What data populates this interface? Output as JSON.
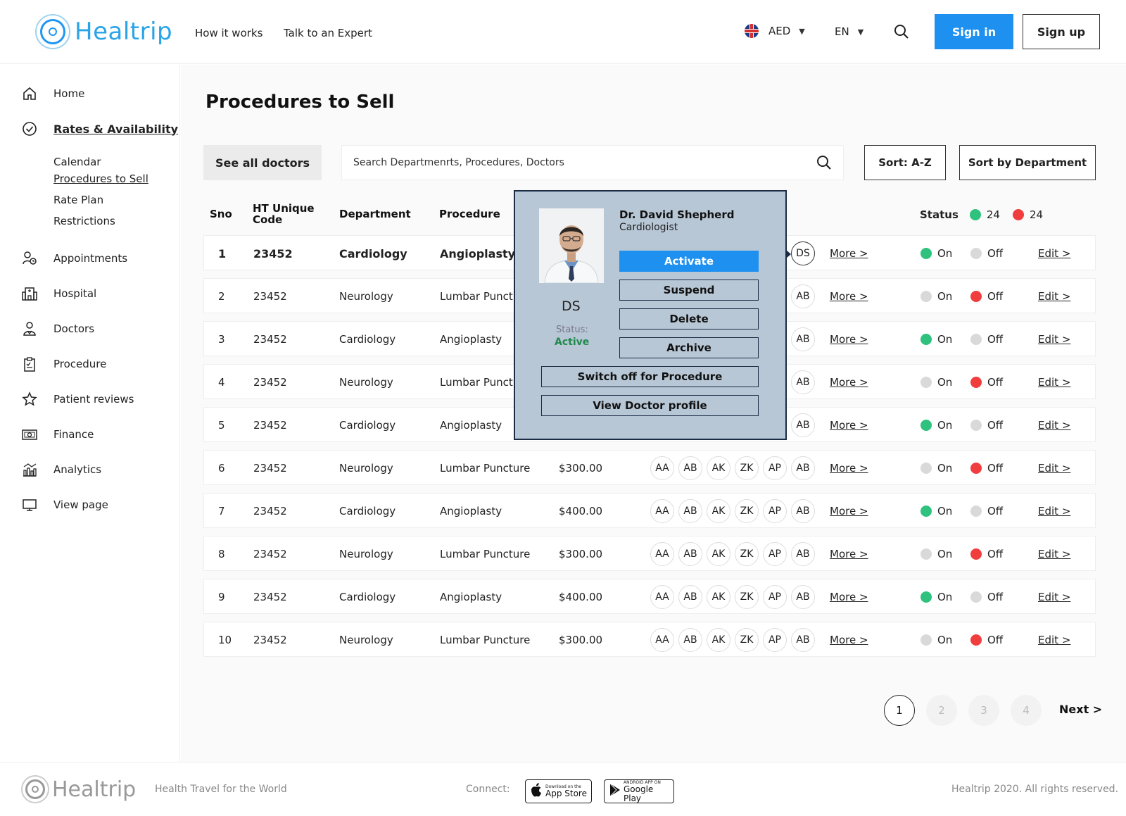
{
  "header": {
    "logo_text": "Healtrip",
    "nav": [
      "How it works",
      "Talk to an Expert"
    ],
    "currency": "AED",
    "language": "EN",
    "signin_label": "Sign in",
    "signup_label": "Sign up"
  },
  "sidebar": {
    "items": [
      {
        "label": "Home",
        "icon": "home-icon"
      },
      {
        "label": "Rates & Availability",
        "icon": "check-circle-icon",
        "active": true
      },
      {
        "label": "Appointments",
        "icon": "appointments-icon"
      },
      {
        "label": "Hospital",
        "icon": "hospital-icon"
      },
      {
        "label": "Doctors",
        "icon": "doctor-icon"
      },
      {
        "label": "Procedure",
        "icon": "clipboard-icon"
      },
      {
        "label": "Patient reviews",
        "icon": "star-icon"
      },
      {
        "label": "Finance",
        "icon": "money-icon"
      },
      {
        "label": "Analytics",
        "icon": "analytics-icon"
      },
      {
        "label": "View page",
        "icon": "monitor-icon"
      }
    ],
    "subitems": [
      "Calendar",
      "Procedures to Sell",
      "Rate Plan",
      "Restrictions"
    ]
  },
  "main": {
    "title": "Procedures to Sell",
    "see_all_label": "See all doctors",
    "search_placeholder": "Search Departmenrts, Procedures, Doctors",
    "sort_az_label": "Sort: A-Z",
    "sort_dept_label": "Sort by Department"
  },
  "table": {
    "headers": {
      "sno": "Sno",
      "code_line1": "HT Unique",
      "code_line2": "Code",
      "department": "Department",
      "procedure": "Procedure",
      "status": "Status"
    },
    "status_counts": {
      "on": "24",
      "off": "24"
    },
    "more_label": "More >",
    "edit_label": "Edit >",
    "on_label": "On",
    "off_label": "Off",
    "rows": [
      {
        "sno": "1",
        "code": "23452",
        "department": "Cardiology",
        "procedure": "Angioplasty",
        "price": "",
        "doctors": [
          "DS"
        ],
        "status": "on"
      },
      {
        "sno": "2",
        "code": "23452",
        "department": "Neurology",
        "procedure": "Lumbar Puncture",
        "price": "",
        "doctors": [
          "AB"
        ],
        "status": "off"
      },
      {
        "sno": "3",
        "code": "23452",
        "department": "Cardiology",
        "procedure": "Angioplasty",
        "price": "",
        "doctors": [
          "AB"
        ],
        "status": "on"
      },
      {
        "sno": "4",
        "code": "23452",
        "department": "Neurology",
        "procedure": "Lumbar Puncture",
        "price": "",
        "doctors": [
          "AB"
        ],
        "status": "off"
      },
      {
        "sno": "5",
        "code": "23452",
        "department": "Cardiology",
        "procedure": "Angioplasty",
        "price": "",
        "doctors": [
          "AB"
        ],
        "status": "on"
      },
      {
        "sno": "6",
        "code": "23452",
        "department": "Neurology",
        "procedure": "Lumbar Puncture",
        "price": "$300.00",
        "doctors": [
          "AA",
          "AB",
          "AK",
          "ZK",
          "AP",
          "AB"
        ],
        "status": "off"
      },
      {
        "sno": "7",
        "code": "23452",
        "department": "Cardiology",
        "procedure": "Angioplasty",
        "price": "$400.00",
        "doctors": [
          "AA",
          "AB",
          "AK",
          "ZK",
          "AP",
          "AB"
        ],
        "status": "on"
      },
      {
        "sno": "8",
        "code": "23452",
        "department": "Neurology",
        "procedure": "Lumbar Puncture",
        "price": "$300.00",
        "doctors": [
          "AA",
          "AB",
          "AK",
          "ZK",
          "AP",
          "AB"
        ],
        "status": "off"
      },
      {
        "sno": "9",
        "code": "23452",
        "department": "Cardiology",
        "procedure": "Angioplasty",
        "price": "$400.00",
        "doctors": [
          "AA",
          "AB",
          "AK",
          "ZK",
          "AP",
          "AB"
        ],
        "status": "on"
      },
      {
        "sno": "10",
        "code": "23452",
        "department": "Neurology",
        "procedure": "Lumbar Puncture",
        "price": "$300.00",
        "doctors": [
          "AA",
          "AB",
          "AK",
          "ZK",
          "AP",
          "AB"
        ],
        "status": "off"
      }
    ]
  },
  "popover": {
    "name": "Dr. David Shepherd",
    "specialty": "Cardiologist",
    "initials": "DS",
    "status_label": "Status:",
    "status_value": "Active",
    "buttons": {
      "activate": "Activate",
      "suspend": "Suspend",
      "delete": "Delete",
      "archive": "Archive",
      "switch_off": "Switch off for Procedure",
      "view_profile": "View Doctor profile"
    }
  },
  "pagination": {
    "pages": [
      "1",
      "2",
      "3",
      "4"
    ],
    "current": "1",
    "next_label": "Next >"
  },
  "footer": {
    "logo_text": "Healtrip",
    "tagline": "Health Travel for the World",
    "connect_label": "Connect:",
    "appstore_small": "Download on the",
    "appstore_big": "App Store",
    "googleplay_small": "ANDROID APP ON",
    "googleplay_big": "Google Play",
    "rights": "Healtrip 2020. All rights reserved."
  },
  "colors": {
    "accent": "#1e90f0",
    "on": "#2ec27e",
    "off": "#f03e3e",
    "popover_bg": "#b8c7d6"
  }
}
